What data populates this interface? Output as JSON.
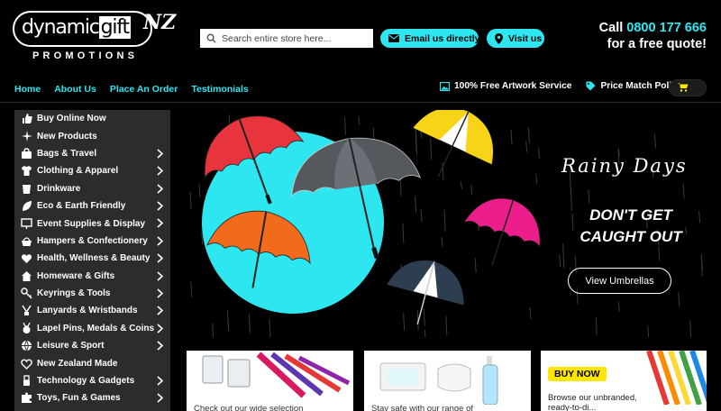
{
  "logo": {
    "word1": "dynamic",
    "word2": "gift",
    "country": "NZ",
    "subtitle": "PROMOTIONS"
  },
  "search": {
    "placeholder": "Search entire store here..."
  },
  "header_buttons": {
    "email": "Email us directly",
    "visit": "Visit us"
  },
  "callout": {
    "call_prefix": "Call ",
    "phone": "0800 177 666",
    "line2": "for a free quote!"
  },
  "nav": [
    "Home",
    "About Us",
    "Place An Order",
    "Testimonials"
  ],
  "services": {
    "artwork": "100% Free Artwork Service",
    "price": "Price Match Policy"
  },
  "sidebar": {
    "items": [
      {
        "label": "Buy Online Now",
        "icon": "thumbs-up-icon",
        "has_children": false
      },
      {
        "label": "New Products",
        "icon": "sparkle-icon",
        "has_children": false
      },
      {
        "label": "Bags & Travel",
        "icon": "bag-icon",
        "has_children": true
      },
      {
        "label": "Clothing & Apparel",
        "icon": "shirt-icon",
        "has_children": true
      },
      {
        "label": "Drinkware",
        "icon": "cup-icon",
        "has_children": true
      },
      {
        "label": "Eco & Earth Friendly",
        "icon": "leaf-icon",
        "has_children": true
      },
      {
        "label": "Event Supplies & Display",
        "icon": "display-icon",
        "has_children": true
      },
      {
        "label": "Hampers & Confectionery",
        "icon": "hamper-icon",
        "has_children": true
      },
      {
        "label": "Health, Wellness & Beauty",
        "icon": "heartbeat-icon",
        "has_children": true
      },
      {
        "label": "Homeware & Gifts",
        "icon": "home-icon",
        "has_children": true
      },
      {
        "label": "Keyrings & Tools",
        "icon": "key-icon",
        "has_children": true
      },
      {
        "label": "Lanyards & Wristbands",
        "icon": "lanyard-icon",
        "has_children": true
      },
      {
        "label": "Lapel Pins, Medals & Coins",
        "icon": "medal-icon",
        "has_children": true
      },
      {
        "label": "Leisure & Sport",
        "icon": "ball-icon",
        "has_children": true
      },
      {
        "label": "New Zealand Made",
        "icon": "heart-icon",
        "has_children": false
      },
      {
        "label": "Technology & Gadgets",
        "icon": "usb-icon",
        "has_children": true
      },
      {
        "label": "Toys, Fun & Games",
        "icon": "puzzle-icon",
        "has_children": true
      }
    ]
  },
  "hero": {
    "script_title": "Rainy Days",
    "headline_line1": "DON'T GET",
    "headline_line2": "CAUGHT OUT",
    "button": "View Umbrellas",
    "colors": {
      "accent": "#2ee6f0",
      "red": "#e8343c",
      "orange": "#f26a1b",
      "yellow": "#f7d417",
      "pink": "#ec1e8c",
      "navy": "#2c3e50"
    }
  },
  "cards": {
    "card1_text": "Check out our wide selection",
    "card2_text": "Stay safe with our range of",
    "card3_badge": "BUY NOW",
    "card3_line1": "Browse our unbranded,",
    "card3_line2": "ready-to-di..."
  }
}
